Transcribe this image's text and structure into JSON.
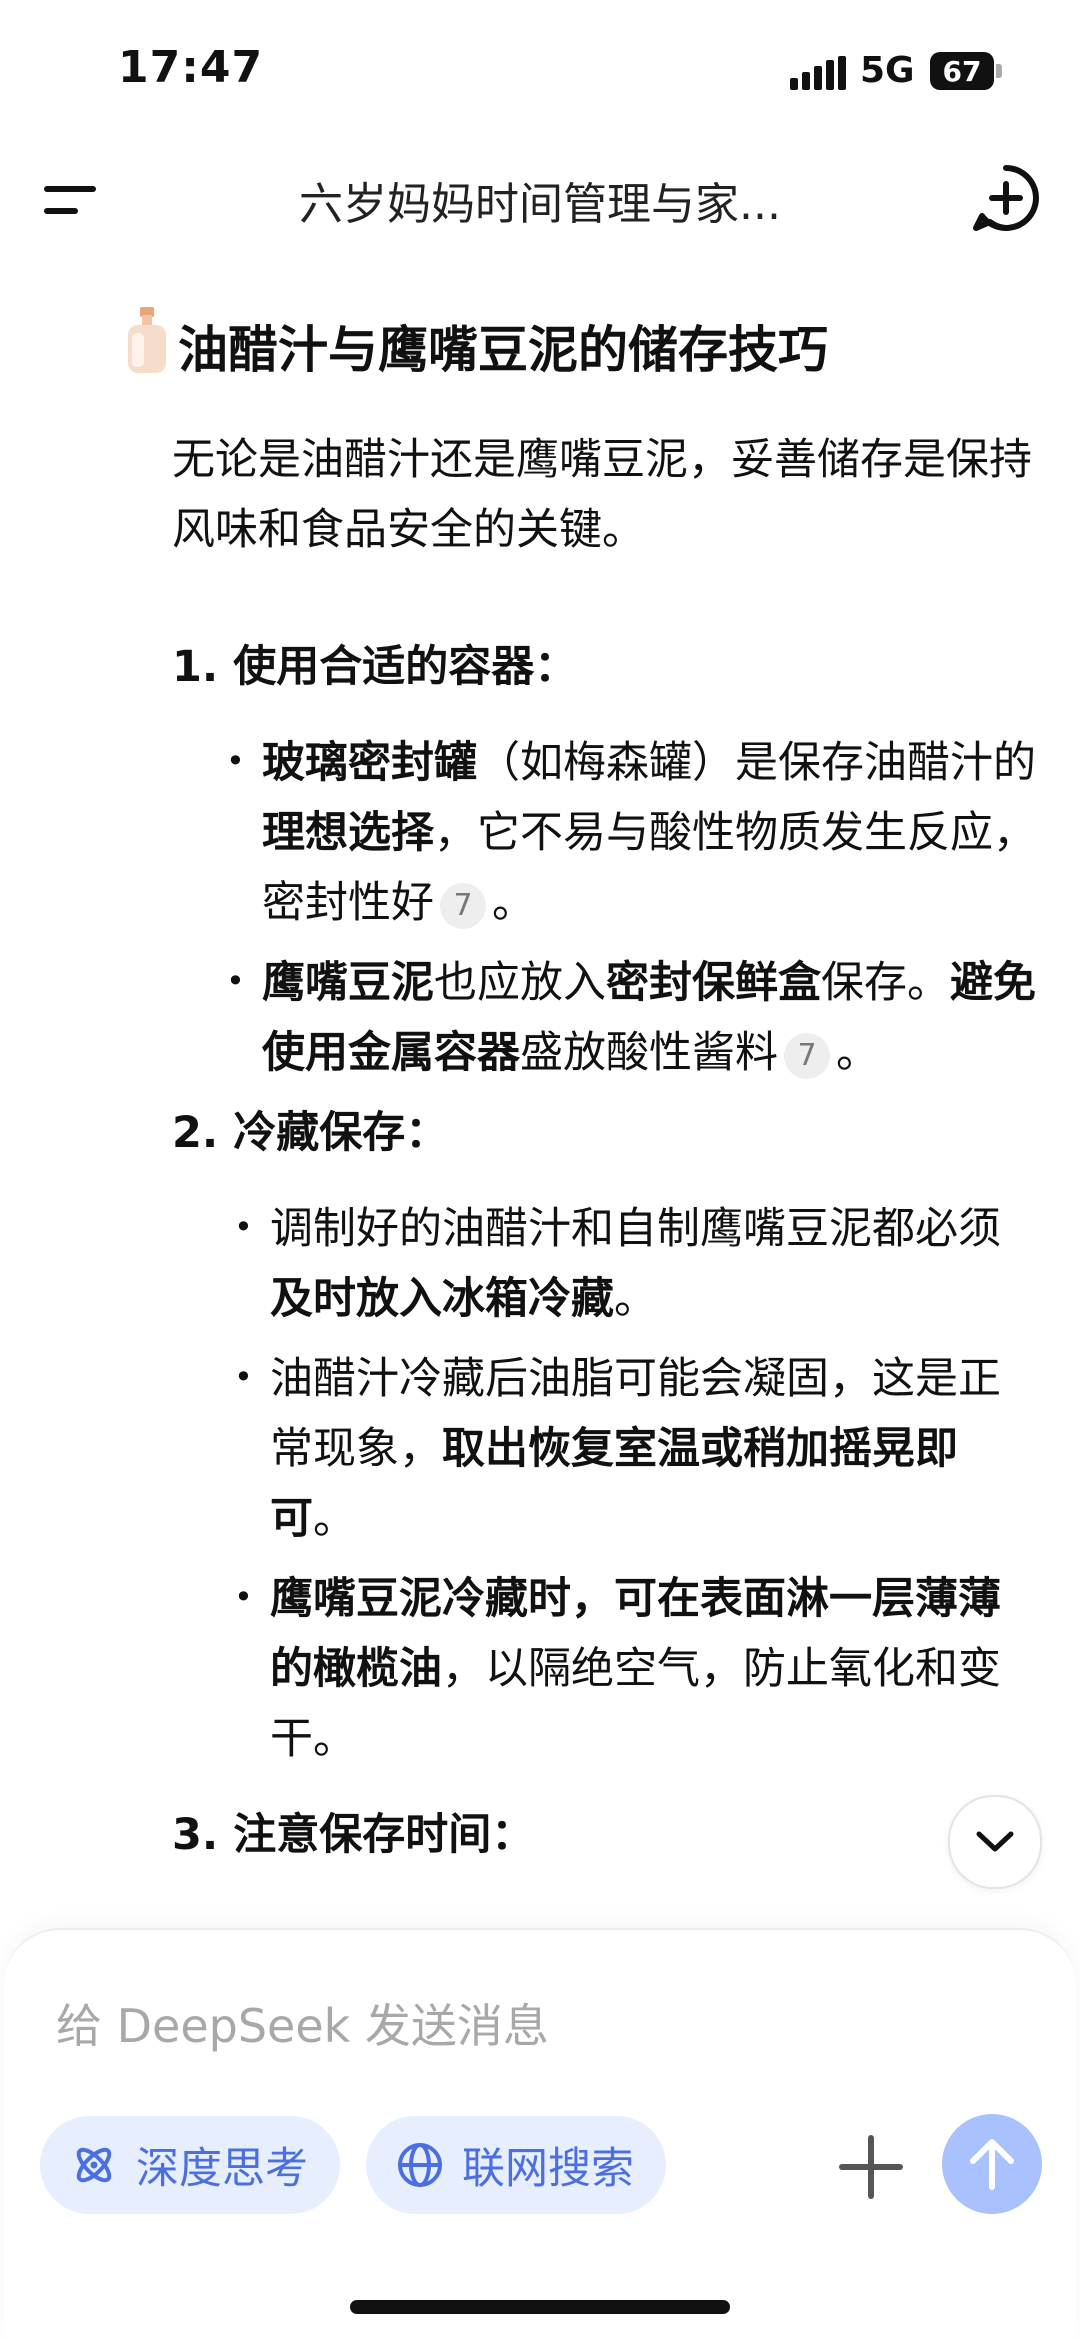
{
  "status_bar": {
    "time": "17:47",
    "network": "5G",
    "battery": "67"
  },
  "header": {
    "title": "六岁妈妈时间管理与家...",
    "menu_icon": "menu-icon",
    "new_chat_icon": "new-chat-icon"
  },
  "article": {
    "heading": "油醋汁与鹰嘴豆泥的储存技巧",
    "heading_icon": "lotion-bottle-emoji",
    "intro": "无论是油醋汁还是鹰嘴豆泥，妥善储存是保持风味和食品安全的关键。",
    "sections": [
      {
        "title": "1. 使用合适的容器：",
        "bullets": [
          {
            "parts": [
              {
                "b": "玻璃密封罐"
              },
              {
                "t": "（如梅森罐）是保存油醋汁的"
              },
              {
                "b": "理想选择"
              },
              {
                "t": "，它不易与酸性物质发生反应，密封性好"
              },
              {
                "c": "7"
              },
              {
                "t": "。"
              }
            ]
          },
          {
            "parts": [
              {
                "b": "鹰嘴豆泥"
              },
              {
                "t": "也应放入"
              },
              {
                "b": "密封保鲜盒"
              },
              {
                "t": "保存。"
              },
              {
                "b": "避免使用金属容器"
              },
              {
                "t": "盛放酸性酱料"
              },
              {
                "c": "7"
              },
              {
                "t": "。"
              }
            ]
          }
        ]
      },
      {
        "title": "2. 冷藏保存：",
        "bullets": [
          {
            "parts": [
              {
                "t": "调制好的油醋汁和自制鹰嘴豆泥都必须"
              },
              {
                "b": "及时放入冰箱冷藏"
              },
              {
                "t": "。"
              }
            ]
          },
          {
            "parts": [
              {
                "t": "油醋汁冷藏后油脂可能会凝固，这是正常现象，"
              },
              {
                "b": "取出恢复室温或稍加摇晃即可"
              },
              {
                "t": "。"
              }
            ]
          },
          {
            "parts": [
              {
                "b": "鹰嘴豆泥冷藏时，可在表面淋一层薄薄的橄榄油"
              },
              {
                "t": "，以隔绝空气，防止氧化和变干。"
              }
            ]
          }
        ]
      },
      {
        "title": "3. 注意保存时间："
      }
    ]
  },
  "composer": {
    "placeholder": "给 DeepSeek 发送消息",
    "deep_think_label": "深度思考",
    "web_search_label": "联网搜索"
  }
}
